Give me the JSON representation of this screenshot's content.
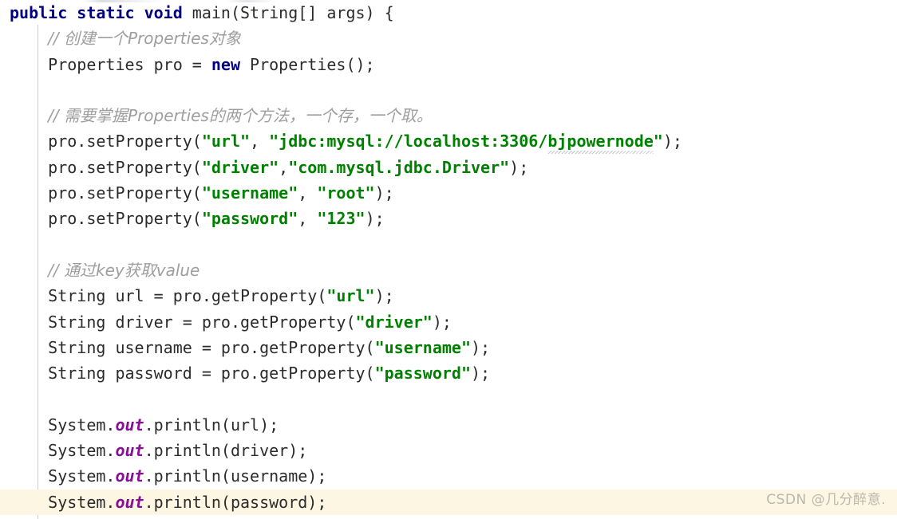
{
  "editor": {
    "language": "Java",
    "background_color": "#ffffff",
    "current_line_highlight_color": "#fdf6e3",
    "indent_guide_color": "#c9ccd4",
    "colors": {
      "keyword": "#000080",
      "string": "#008000",
      "comment": "#9e9e9e",
      "static_field": "#871094",
      "default_text": "#2b2b2b"
    },
    "lines": [
      {
        "number": 1,
        "indent": 0,
        "current": false,
        "tokens": [
          {
            "type": "kw",
            "text": "public"
          },
          {
            "type": "plain",
            "text": " "
          },
          {
            "type": "kw",
            "text": "static"
          },
          {
            "type": "plain",
            "text": " "
          },
          {
            "type": "kw",
            "text": "void"
          },
          {
            "type": "plain",
            "text": " main(String[] args) {"
          }
        ]
      },
      {
        "number": 2,
        "indent": 1,
        "current": false,
        "tokens": [
          {
            "type": "cmt",
            "text": "// 创建一个Properties对象"
          }
        ]
      },
      {
        "number": 3,
        "indent": 1,
        "current": false,
        "tokens": [
          {
            "type": "plain",
            "text": "Properties pro = "
          },
          {
            "type": "kw",
            "text": "new"
          },
          {
            "type": "plain",
            "text": " Properties();"
          }
        ]
      },
      {
        "number": 4,
        "indent": 1,
        "current": false,
        "tokens": []
      },
      {
        "number": 5,
        "indent": 1,
        "current": false,
        "tokens": [
          {
            "type": "cmt",
            "text": "// 需要掌握Properties的两个方法，一个存，一个取。"
          }
        ]
      },
      {
        "number": 6,
        "indent": 1,
        "current": false,
        "tokens": [
          {
            "type": "plain",
            "text": "pro.setProperty("
          },
          {
            "type": "str",
            "text": "\"url\""
          },
          {
            "type": "plain",
            "text": ", "
          },
          {
            "type": "str",
            "text": "\"jdbc:mysql://localhost:3306/"
          },
          {
            "type": "str-squiggle",
            "text": "bjpowernode"
          },
          {
            "type": "str",
            "text": "\""
          },
          {
            "type": "plain",
            "text": ");"
          }
        ]
      },
      {
        "number": 7,
        "indent": 1,
        "current": false,
        "tokens": [
          {
            "type": "plain",
            "text": "pro.setProperty("
          },
          {
            "type": "str",
            "text": "\"driver\""
          },
          {
            "type": "plain",
            "text": ","
          },
          {
            "type": "str",
            "text": "\"com.mysql.jdbc.Driver\""
          },
          {
            "type": "plain",
            "text": ");"
          }
        ]
      },
      {
        "number": 8,
        "indent": 1,
        "current": false,
        "tokens": [
          {
            "type": "plain",
            "text": "pro.setProperty("
          },
          {
            "type": "str",
            "text": "\"username\""
          },
          {
            "type": "plain",
            "text": ", "
          },
          {
            "type": "str",
            "text": "\"root\""
          },
          {
            "type": "plain",
            "text": ");"
          }
        ]
      },
      {
        "number": 9,
        "indent": 1,
        "current": false,
        "tokens": [
          {
            "type": "plain",
            "text": "pro.setProperty("
          },
          {
            "type": "str",
            "text": "\"password\""
          },
          {
            "type": "plain",
            "text": ", "
          },
          {
            "type": "str",
            "text": "\"123\""
          },
          {
            "type": "plain",
            "text": ");"
          }
        ]
      },
      {
        "number": 10,
        "indent": 1,
        "current": false,
        "tokens": []
      },
      {
        "number": 11,
        "indent": 1,
        "current": false,
        "tokens": [
          {
            "type": "cmt",
            "text": "// 通过key获取value"
          }
        ]
      },
      {
        "number": 12,
        "indent": 1,
        "current": false,
        "tokens": [
          {
            "type": "plain",
            "text": "String url = pro.getProperty("
          },
          {
            "type": "str",
            "text": "\"url\""
          },
          {
            "type": "plain",
            "text": ");"
          }
        ]
      },
      {
        "number": 13,
        "indent": 1,
        "current": false,
        "tokens": [
          {
            "type": "plain",
            "text": "String driver = pro.getProperty("
          },
          {
            "type": "str",
            "text": "\"driver\""
          },
          {
            "type": "plain",
            "text": ");"
          }
        ]
      },
      {
        "number": 14,
        "indent": 1,
        "current": false,
        "tokens": [
          {
            "type": "plain",
            "text": "String username = pro.getProperty("
          },
          {
            "type": "str",
            "text": "\"username\""
          },
          {
            "type": "plain",
            "text": ");"
          }
        ]
      },
      {
        "number": 15,
        "indent": 1,
        "current": false,
        "tokens": [
          {
            "type": "plain",
            "text": "String password = pro.getProperty("
          },
          {
            "type": "str",
            "text": "\"password\""
          },
          {
            "type": "plain",
            "text": ");"
          }
        ]
      },
      {
        "number": 16,
        "indent": 1,
        "current": false,
        "tokens": []
      },
      {
        "number": 17,
        "indent": 1,
        "current": false,
        "tokens": [
          {
            "type": "plain",
            "text": "System."
          },
          {
            "type": "field",
            "text": "out"
          },
          {
            "type": "plain",
            "text": ".println(url);"
          }
        ]
      },
      {
        "number": 18,
        "indent": 1,
        "current": false,
        "tokens": [
          {
            "type": "plain",
            "text": "System."
          },
          {
            "type": "field",
            "text": "out"
          },
          {
            "type": "plain",
            "text": ".println(driver);"
          }
        ]
      },
      {
        "number": 19,
        "indent": 1,
        "current": false,
        "tokens": [
          {
            "type": "plain",
            "text": "System."
          },
          {
            "type": "field",
            "text": "out"
          },
          {
            "type": "plain",
            "text": ".println(username);"
          }
        ]
      },
      {
        "number": 20,
        "indent": 1,
        "current": true,
        "tokens": [
          {
            "type": "plain",
            "text": "System."
          },
          {
            "type": "field",
            "text": "out"
          },
          {
            "type": "plain",
            "text": ".println(password);"
          }
        ]
      }
    ]
  },
  "watermark": {
    "text": "CSDN @几分醉意."
  }
}
